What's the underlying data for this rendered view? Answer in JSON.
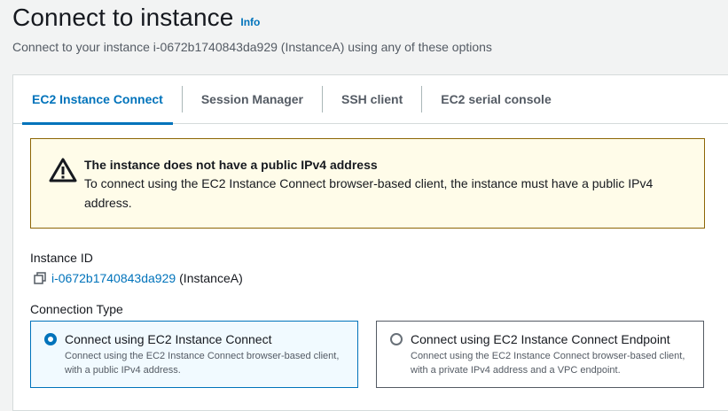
{
  "header": {
    "title": "Connect to instance",
    "info_label": "Info",
    "subtitle": "Connect to your instance i-0672b1740843da929 (InstanceA) using any of these options"
  },
  "tabs": [
    {
      "label": "EC2 Instance Connect",
      "active": true
    },
    {
      "label": "Session Manager",
      "active": false
    },
    {
      "label": "SSH client",
      "active": false
    },
    {
      "label": "EC2 serial console",
      "active": false
    }
  ],
  "alert": {
    "type": "warning",
    "icon": "warning-icon",
    "title": "The instance does not have a public IPv4 address",
    "body": "To connect using the EC2 Instance Connect browser-based client, the instance must have a public IPv4 address."
  },
  "instance": {
    "label": "Instance ID",
    "id": "i-0672b1740843da929",
    "name": "(InstanceA)",
    "icon": "copy-icon"
  },
  "connection_type": {
    "label": "Connection Type",
    "options": [
      {
        "title": "Connect using EC2 Instance Connect",
        "description": "Connect using the EC2 Instance Connect browser-based client, with a public IPv4 address.",
        "selected": true
      },
      {
        "title": "Connect using EC2 Instance Connect Endpoint",
        "description": "Connect using the EC2 Instance Connect browser-based client, with a private IPv4 address and a VPC endpoint.",
        "selected": false
      }
    ]
  },
  "colors": {
    "accent": "#0073bb",
    "warning_border": "#8d6605",
    "warning_bg": "#fffce9",
    "selected_bg": "#f1faff"
  }
}
